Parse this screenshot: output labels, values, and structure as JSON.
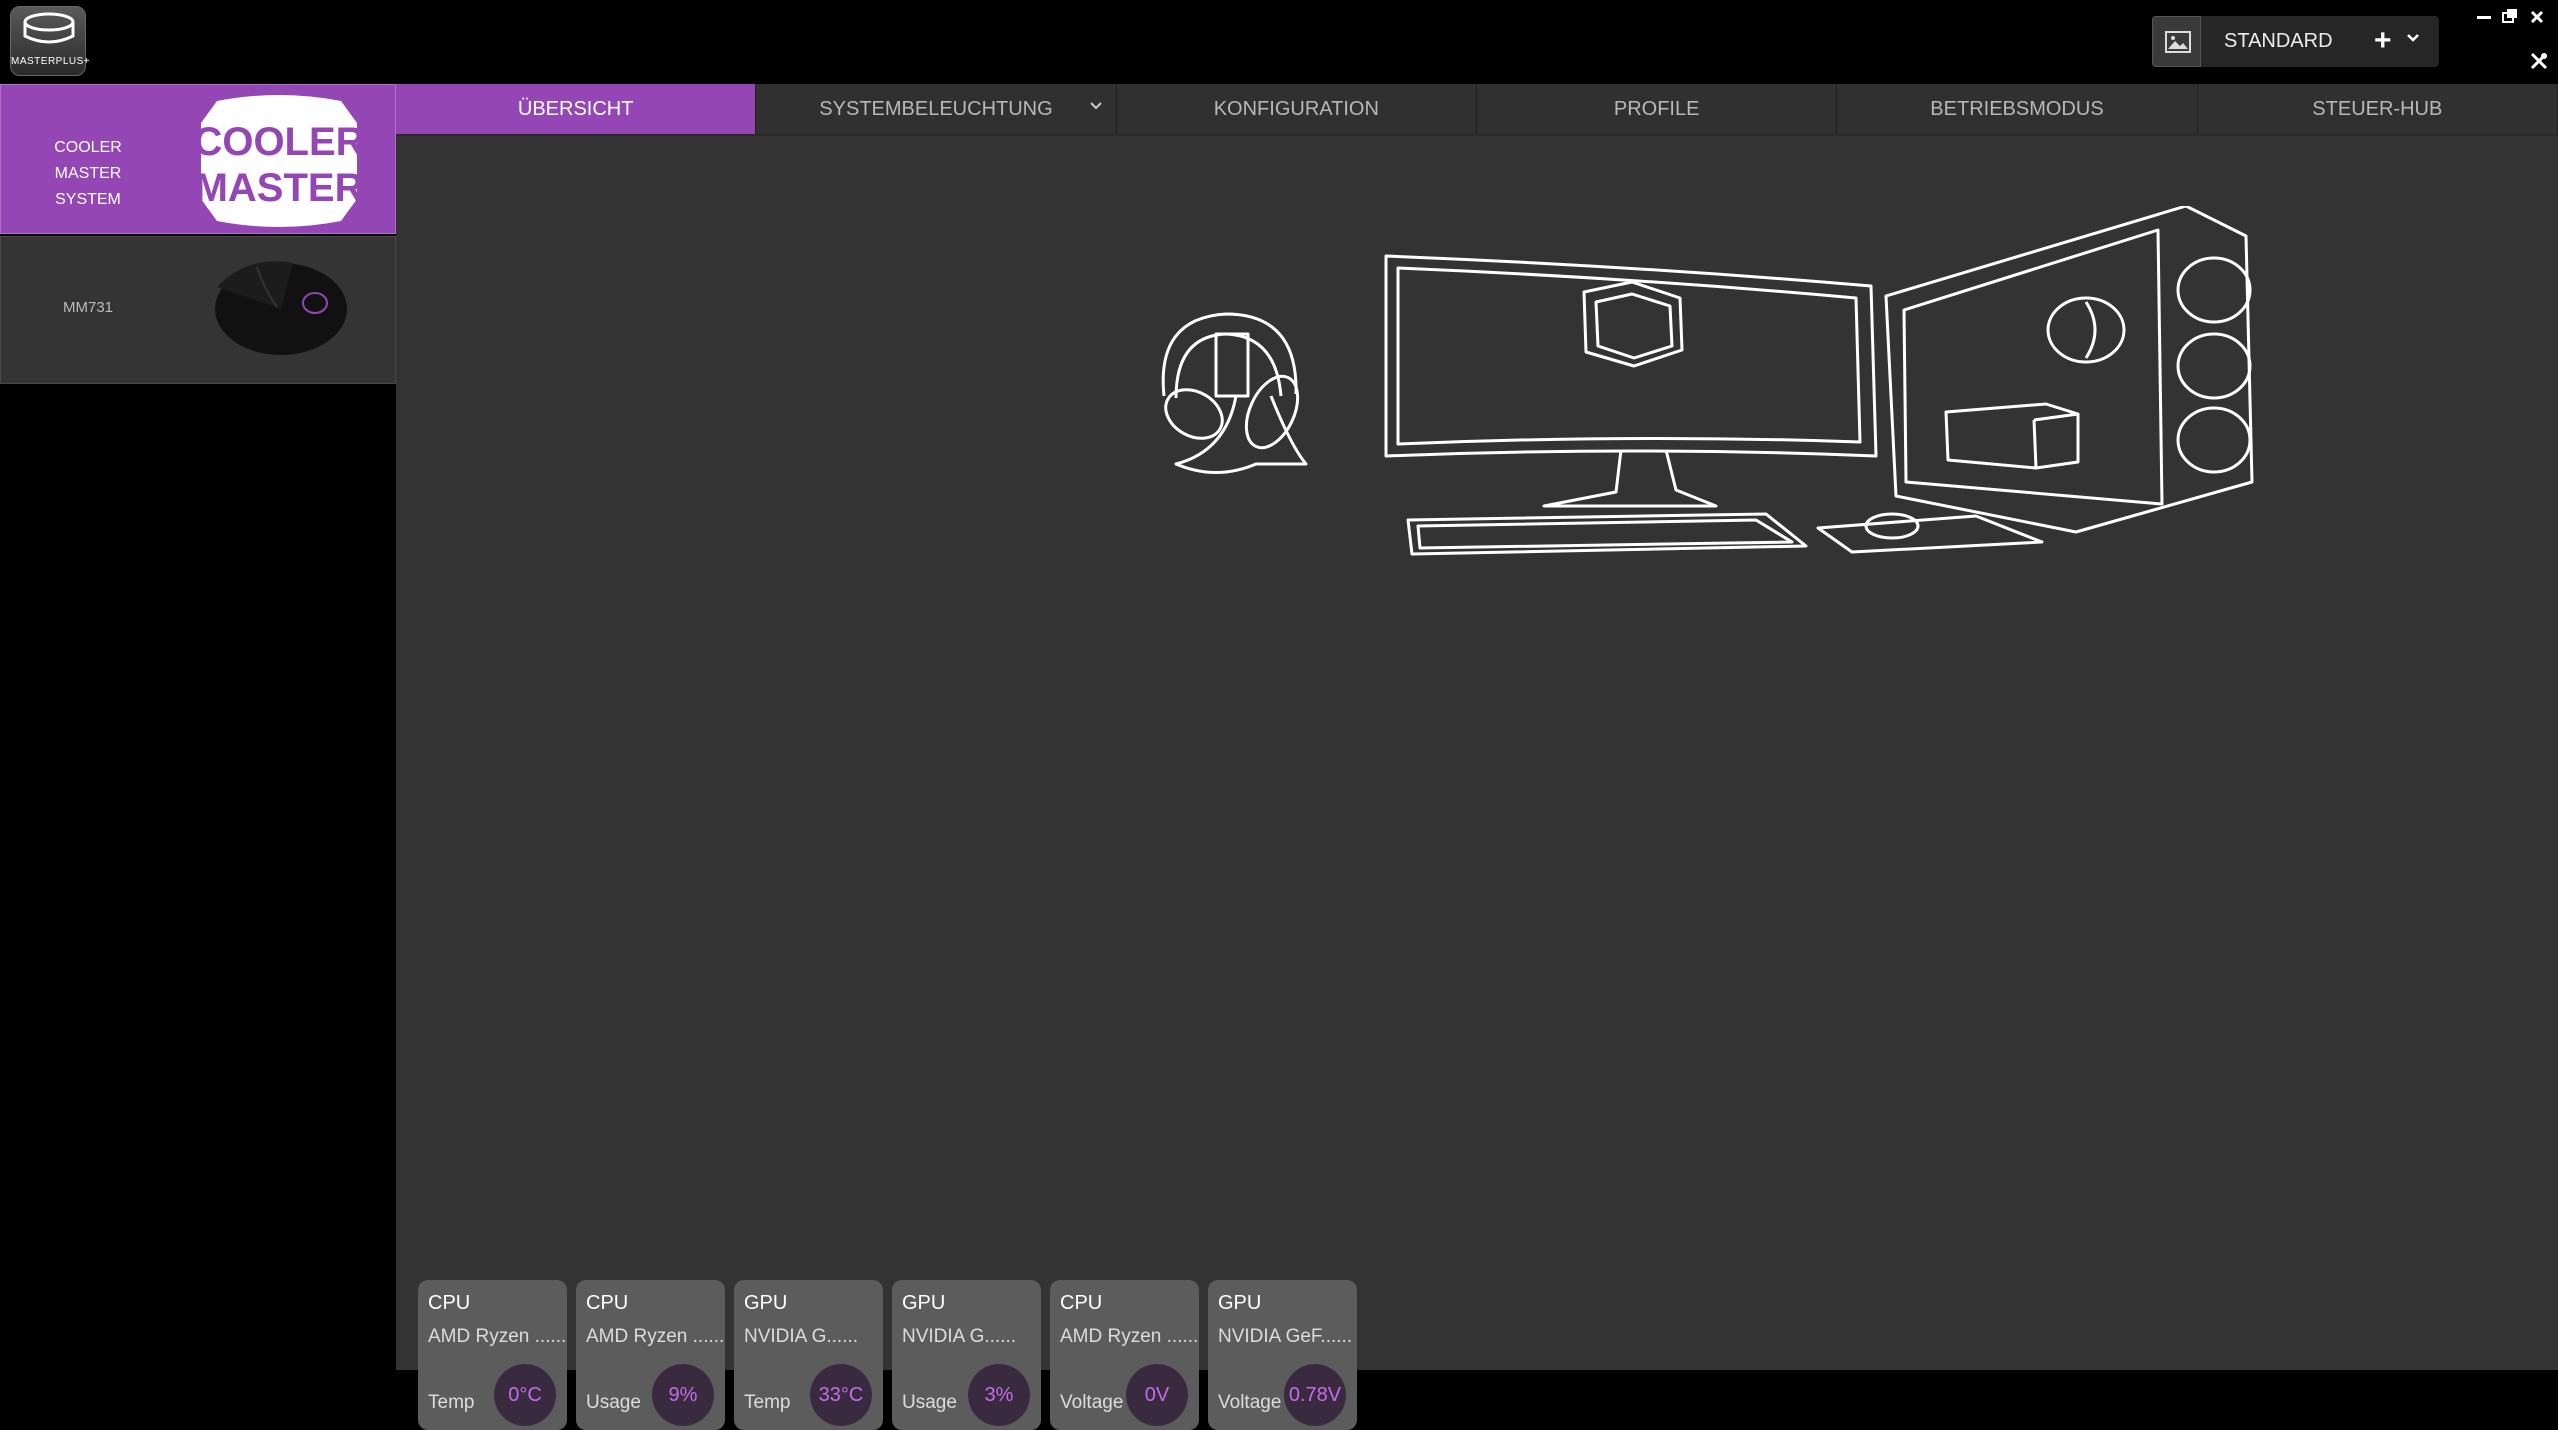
{
  "app": {
    "logo_text": "MASTERPLUS+",
    "profile": {
      "name": "STANDARD",
      "add_label": "+",
      "dropdown_label": "⌄"
    },
    "window_controls": {
      "minimize": "–",
      "restore": "❐",
      "close": "✕",
      "tools": "⚒"
    }
  },
  "sidebar": {
    "devices": [
      {
        "label": "COOLER MASTER SYSTEM",
        "logo_text_1": "COOLER",
        "logo_text_2": "MASTER",
        "selected": true
      },
      {
        "label": "MM731",
        "selected": false
      }
    ]
  },
  "tabs": [
    {
      "label": "ÜBERSICHT",
      "active": true
    },
    {
      "label": "SYSTEMBELEUCHTUNG",
      "has_dropdown": true
    },
    {
      "label": "KONFIGURATION"
    },
    {
      "label": "PROFILE"
    },
    {
      "label": "BETRIEBSMODUS"
    },
    {
      "label": "STEUER-HUB"
    }
  ],
  "widgets": [
    {
      "type": "CPU",
      "name": "AMD Ryzen ......",
      "metric": "Temp",
      "value": "0°C"
    },
    {
      "type": "CPU",
      "name": "AMD Ryzen ......",
      "metric": "Usage",
      "value": "9%"
    },
    {
      "type": "GPU",
      "name": "NVIDIA G......",
      "metric": "Temp",
      "value": "33°C"
    },
    {
      "type": "GPU",
      "name": "NVIDIA G......",
      "metric": "Usage",
      "value": "3%"
    },
    {
      "type": "CPU",
      "name": "AMD Ryzen ......",
      "metric": "Voltage",
      "value": "0V"
    },
    {
      "type": "GPU",
      "name": "NVIDIA GeF......",
      "metric": "Voltage",
      "value": "0.78V"
    }
  ],
  "colors": {
    "accent": "#9447b4",
    "value_text": "#c46de8",
    "panel": "#333333",
    "widget": "#5c5c5c"
  },
  "icons": [
    "masterplus-logo-icon",
    "image-icon",
    "plus-icon",
    "chevron-down-icon",
    "minimize-icon",
    "restore-icon",
    "close-icon",
    "tools-icon",
    "cooler-master-logo",
    "mouse-image",
    "setup-illustration"
  ]
}
